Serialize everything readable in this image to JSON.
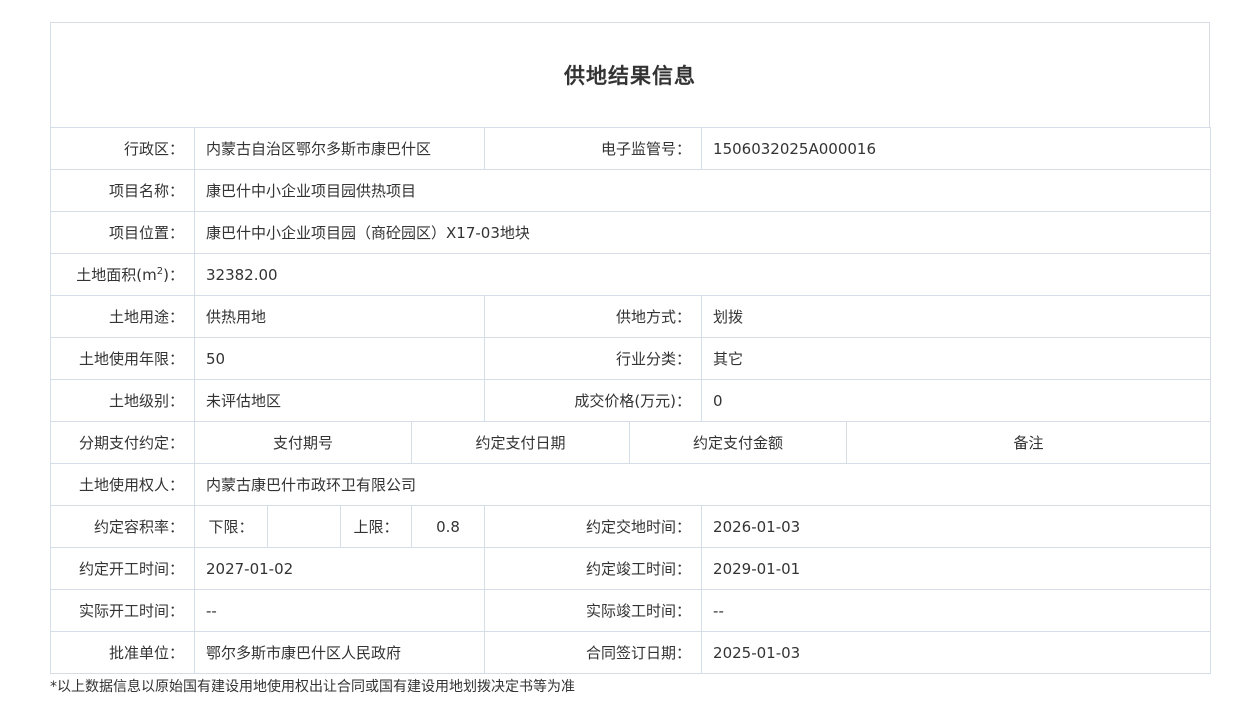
{
  "page": {
    "title": "供地结果信息",
    "footnote": "*以上数据信息以原始国有建设用地使用权出让合同或国有建设用地划拨决定书等为准"
  },
  "labels": {
    "region": "行政区：",
    "supervision_no": "电子监管号：",
    "project_name": "项目名称：",
    "project_location": "项目位置：",
    "land_area_prefix": "土地面积(m",
    "land_area_sup": "2",
    "land_area_suffix": ")：",
    "land_use": "土地用途：",
    "supply_method": "供地方式：",
    "use_term": "土地使用年限：",
    "industry": "行业分类：",
    "land_grade": "土地级别：",
    "deal_price": "成交价格(万元)：",
    "installment": "分期支付约定：",
    "right_holder": "土地使用权人：",
    "plot_ratio": "约定容积率：",
    "lower_limit": "下限：",
    "upper_limit": "上限：",
    "delivery_time": "约定交地时间：",
    "start_time": "约定开工时间：",
    "completion_time": "约定竣工时间：",
    "actual_start": "实际开工时间：",
    "actual_completion": "实际竣工时间：",
    "approval_unit": "批准单位：",
    "contract_date": "合同签订日期："
  },
  "values": {
    "region": "内蒙古自治区鄂尔多斯市康巴什区",
    "supervision_no": "1506032025A000016",
    "project_name": "康巴什中小企业项目园供热项目",
    "project_location": "康巴什中小企业项目园（商砼园区）X17-03地块",
    "land_area": "32382.00",
    "land_use": "供热用地",
    "supply_method": "划拨",
    "use_term": "50",
    "industry": "其它",
    "land_grade": "未评估地区",
    "deal_price": "0",
    "right_holder": "内蒙古康巴什市政环卫有限公司",
    "lower_limit": "",
    "upper_limit": "0.8",
    "delivery_time": "2026-01-03",
    "start_time": "2027-01-02",
    "completion_time": "2029-01-01",
    "actual_start": "--",
    "actual_completion": "--",
    "approval_unit": "鄂尔多斯市康巴什区人民政府",
    "contract_date": "2025-01-03"
  },
  "installment_headers": [
    "支付期号",
    "约定支付日期",
    "约定支付金额",
    "备注"
  ]
}
